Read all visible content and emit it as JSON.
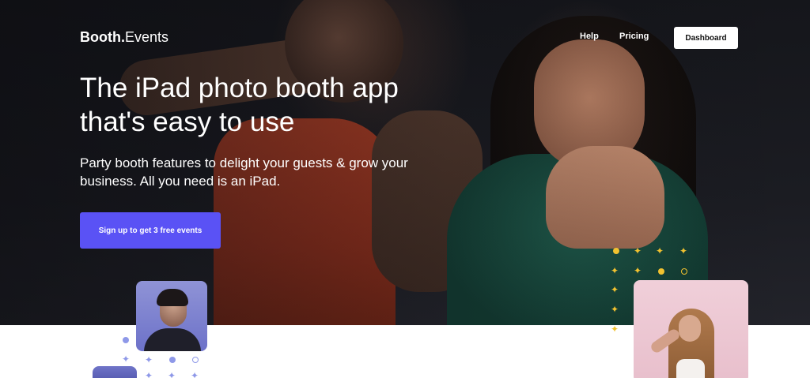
{
  "nav": {
    "logo_bold": "Booth.",
    "logo_light": "Events",
    "links": [
      {
        "label": "Help"
      },
      {
        "label": "Pricing"
      }
    ],
    "dashboard_label": "Dashboard"
  },
  "hero": {
    "headline": "The iPad photo booth app that's easy to use",
    "subhead": "Party booth features to delight your guests & grow your business. All you need is an iPad.",
    "cta_label": "Sign up to get 3 free events"
  },
  "colors": {
    "accent": "#5a52f5",
    "hero_background": "#1b1c22",
    "sparkle_gold": "#f2c230",
    "sparkle_lavender": "#8e98e8"
  },
  "icons": {
    "sparkle": "four-point-star",
    "dot": "filled-circle",
    "ring": "hollow-circle"
  }
}
